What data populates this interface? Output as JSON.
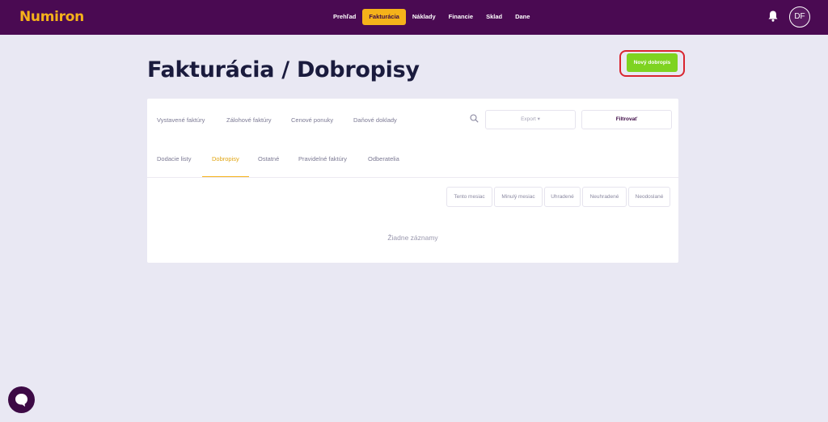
{
  "brand": {
    "name": "Numiron",
    "accent": "#f5b21a",
    "nav_bg": "#4a0a52"
  },
  "nav": {
    "items": [
      "Prehľad",
      "Fakturácia",
      "Náklady",
      "Financie",
      "Sklad",
      "Dane"
    ],
    "active": "Fakturácia",
    "user_initials": "DF",
    "bell_icon": "bell-icon"
  },
  "page": {
    "title": "Fakturácia / Dobropisy",
    "new_button": "Nový dobropis"
  },
  "card": {
    "tabs_row1": [
      "Vystavené faktúry",
      "Zálohové faktúry",
      "Cenové ponuky",
      "Daňové doklady"
    ],
    "tabs_row2": [
      "Dodacie listy",
      "Dobropisy",
      "Ostatné",
      "Pravidelné faktúry",
      "Odberatelia"
    ],
    "active_tab": "Dobropisy",
    "export_label": "Export ▾",
    "filter_label": "Filtrovať",
    "chips": [
      "Tento mesiac",
      "Minulý mesiac",
      "Uhradené",
      "Neuhradené",
      "Neodoslané"
    ],
    "empty_text": "Žiadne záznamy"
  }
}
